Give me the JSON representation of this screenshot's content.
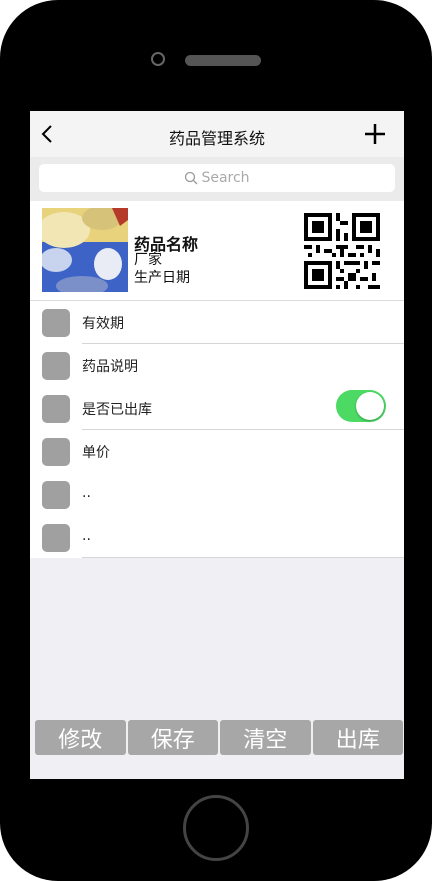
{
  "nav": {
    "title": "药品管理系统",
    "back_icon": "chevron-left-icon",
    "add_icon": "plus-icon"
  },
  "search": {
    "placeholder": "Search"
  },
  "drug": {
    "name": "药品名称",
    "manufacturer": "厂家",
    "production_date": "生产日期"
  },
  "rows": [
    {
      "label": "有效期"
    },
    {
      "label": "药品说明"
    },
    {
      "label": "是否已出库",
      "toggle_on": true
    },
    {
      "label": "单价"
    },
    {
      "label": ".."
    },
    {
      "label": ".."
    }
  ],
  "actions": [
    {
      "label": "修改"
    },
    {
      "label": "保存"
    },
    {
      "label": "清空"
    },
    {
      "label": "出库"
    }
  ],
  "colors": {
    "toggle_on": "#4cd964",
    "button": "#a7a7a7",
    "icon_placeholder": "#a0a0a0"
  }
}
